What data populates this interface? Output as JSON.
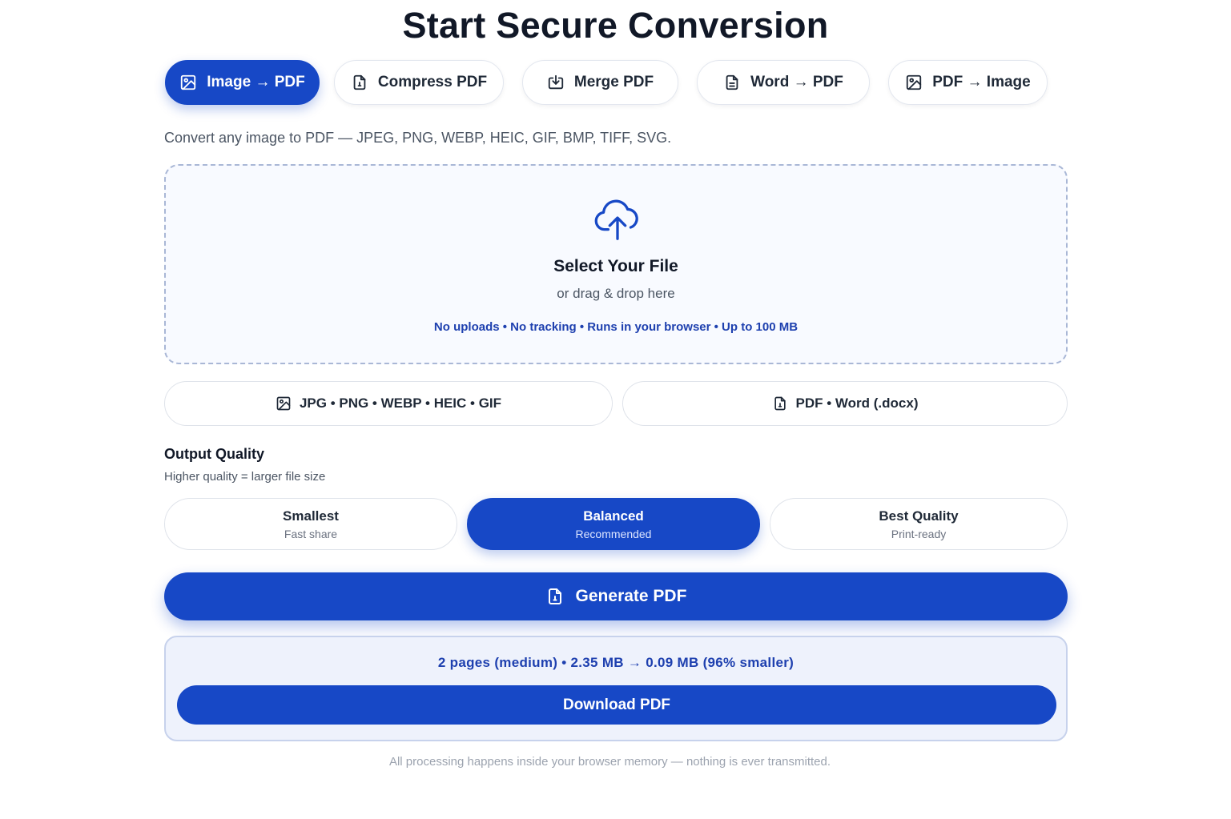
{
  "header": {
    "title": "Start Secure Conversion"
  },
  "tabs": [
    {
      "label": "Image → PDF",
      "icon": "image-icon",
      "active": true
    },
    {
      "label": "Compress PDF",
      "icon": "file-icon",
      "active": false
    },
    {
      "label": "Merge PDF",
      "icon": "tray-download-icon",
      "active": false
    },
    {
      "label": "Word → PDF",
      "icon": "document-icon",
      "active": false
    },
    {
      "label": "PDF → Image",
      "icon": "image-icon",
      "active": false
    }
  ],
  "description": "Convert any image to PDF — JPEG, PNG, WEBP, HEIC, GIF, BMP, TIFF, SVG.",
  "dropzone": {
    "icon": "cloud-upload-icon",
    "title": "Select Your File",
    "subtitle": "or drag & drop here",
    "badges": "No uploads • No tracking • Runs in your browser • Up to 100 MB"
  },
  "formats": [
    {
      "label": "JPG • PNG • WEBP • HEIC • GIF",
      "icon": "image-icon"
    },
    {
      "label": "PDF • Word (.docx)",
      "icon": "file-icon"
    }
  ],
  "output_quality": {
    "title": "Output Quality",
    "subtitle": "Higher quality = larger file size",
    "options": [
      {
        "label": "Smallest",
        "sub": "Fast share",
        "active": false
      },
      {
        "label": "Balanced",
        "sub": "Recommended",
        "active": true
      },
      {
        "label": "Best Quality",
        "sub": "Print-ready",
        "active": false
      }
    ]
  },
  "generate_label": "Generate PDF",
  "result": {
    "stats": "2 pages (medium) • 2.35 MB → 0.09 MB (96% smaller)",
    "download_label": "Download PDF"
  },
  "footnote": "All processing happens inside your browser memory — nothing is ever transmitted.",
  "colors": {
    "accent": "#1748c6",
    "accent_text": "#1e40af",
    "border": "#dfe3ea"
  }
}
